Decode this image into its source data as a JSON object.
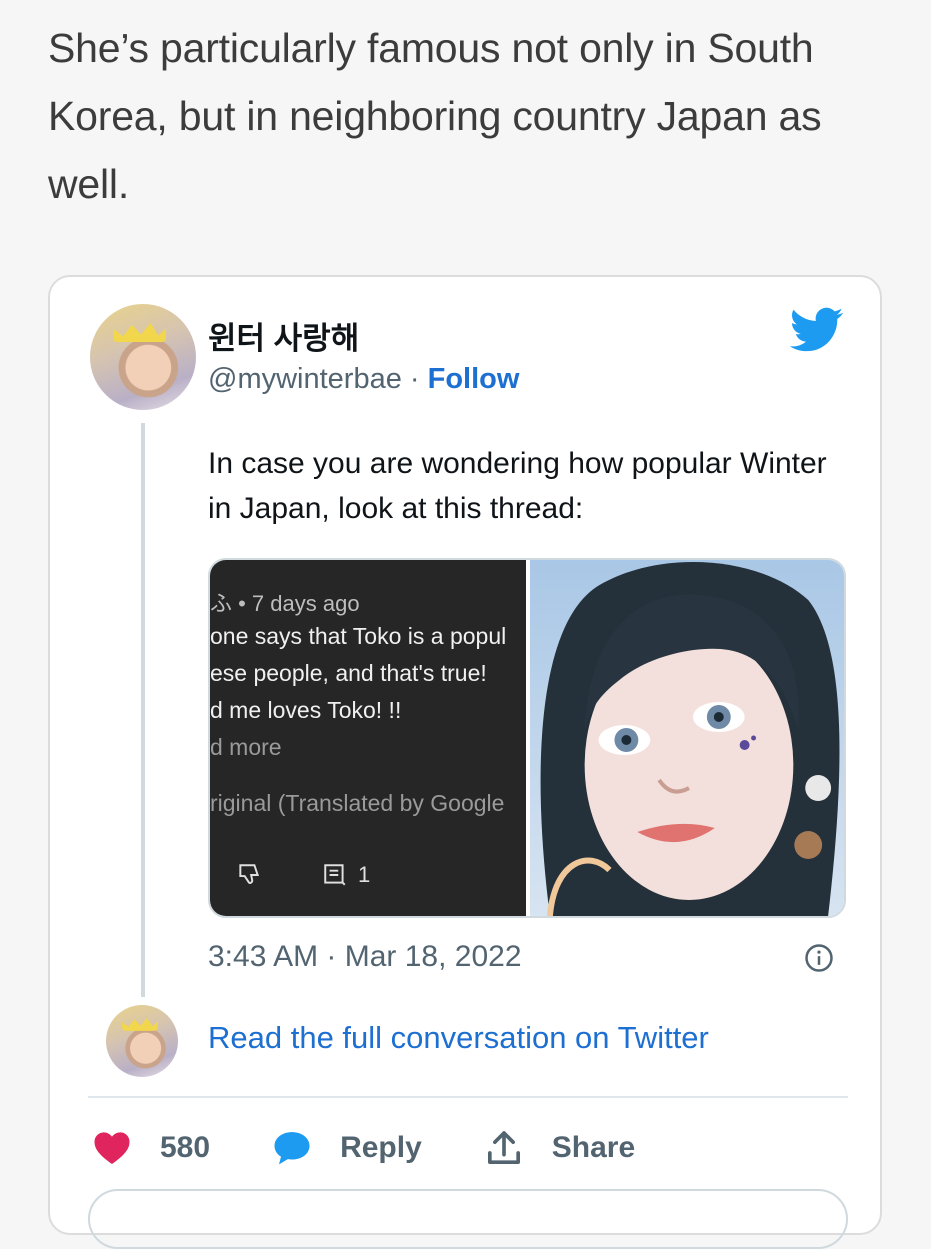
{
  "article": {
    "paragraph": "She’s particularly famous not only in South Korea, but in neighboring country Japan as well."
  },
  "tweet": {
    "display_name": "윈터 사랑해",
    "handle": "@mywinterbae",
    "separator": " · ",
    "follow_label": "Follow",
    "text": "In case you are wondering how popular Winter in Japan, look at this thread:",
    "timestamp": "3:43 AM · Mar 18, 2022",
    "read_full_label": "Read the full conversation on Twitter",
    "likes": "580",
    "reply_label": "Reply",
    "share_label": "Share",
    "screenshot": {
      "meta": "ふ • 7 days ago",
      "line1": "one says that Toko is a popul",
      "line2": "ese people, and that's true!",
      "line3": "d me loves Toko! !!",
      "read_more": "d more",
      "translated": "riginal (Translated by Google",
      "comment_count": "1"
    }
  },
  "colors": {
    "link_blue": "#1d6fd1",
    "twitter_blue": "#1d9bf0",
    "heart_pink": "#e0245e",
    "muted": "#536471"
  },
  "icons": [
    "twitter-bird-icon",
    "info-icon",
    "heart-icon",
    "reply-bubble-icon",
    "share-icon",
    "thumbs-down-icon",
    "comment-icon"
  ]
}
